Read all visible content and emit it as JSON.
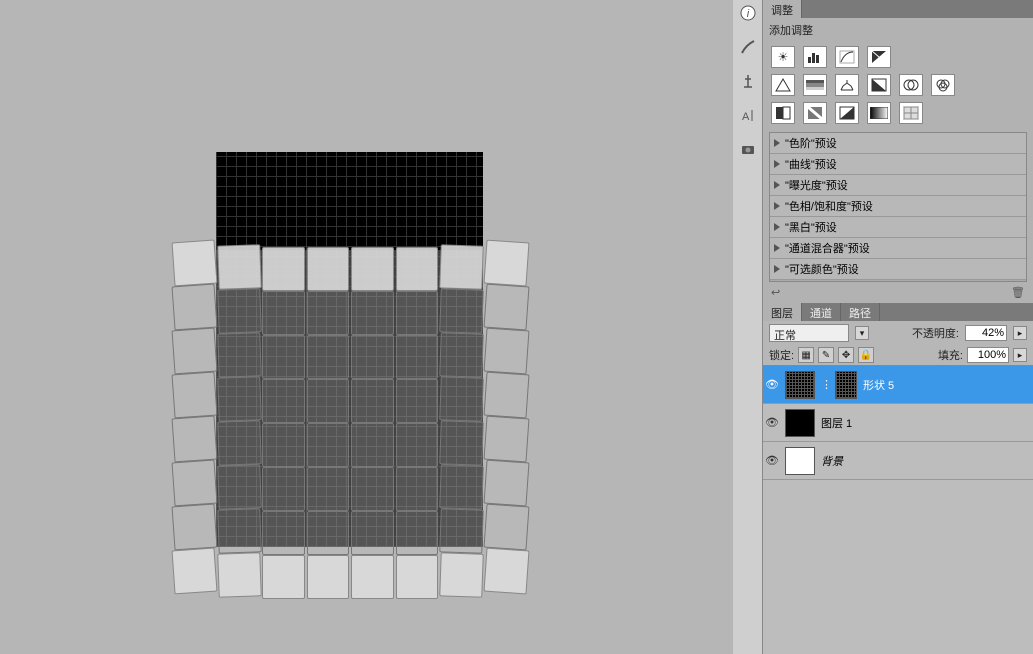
{
  "adjustments": {
    "tab_label": "调整",
    "header": "添加调整",
    "icons_row1": [
      "亮度/对比度",
      "色阶",
      "曲线",
      "曝光度"
    ],
    "icons_row2": [
      "自然饱和",
      "色相/饱和",
      "色彩平衡",
      "黑白",
      "照片滤镜",
      "通道混合"
    ],
    "icons_row3": [
      "反相",
      "色调分离",
      "阈值",
      "渐变映射",
      "可选颜色"
    ],
    "presets": [
      "\"色阶\"预设",
      "\"曲线\"预设",
      "\"曝光度\"预设",
      "\"色相/饱和度\"预设",
      "\"黑白\"预设",
      "\"通道混合器\"预设",
      "\"可选颜色\"预设"
    ]
  },
  "layers_panel": {
    "tabs": {
      "layers": "图层",
      "channels": "通道",
      "paths": "路径"
    },
    "blend_mode_label": "正常",
    "opacity_label": "不透明度:",
    "opacity_value": "42%",
    "lock_label": "锁定:",
    "fill_label": "填充:",
    "fill_value": "100%",
    "layers": [
      {
        "name": "形状 5",
        "selected": true,
        "thumb": "grid"
      },
      {
        "name": "图层 1",
        "selected": false,
        "thumb": "black"
      },
      {
        "name": "背景",
        "selected": false,
        "thumb": "white"
      }
    ]
  },
  "vtoolbar": [
    "info-icon",
    "brush-icon",
    "clone-icon",
    "type-icon",
    "camera-icon"
  ]
}
